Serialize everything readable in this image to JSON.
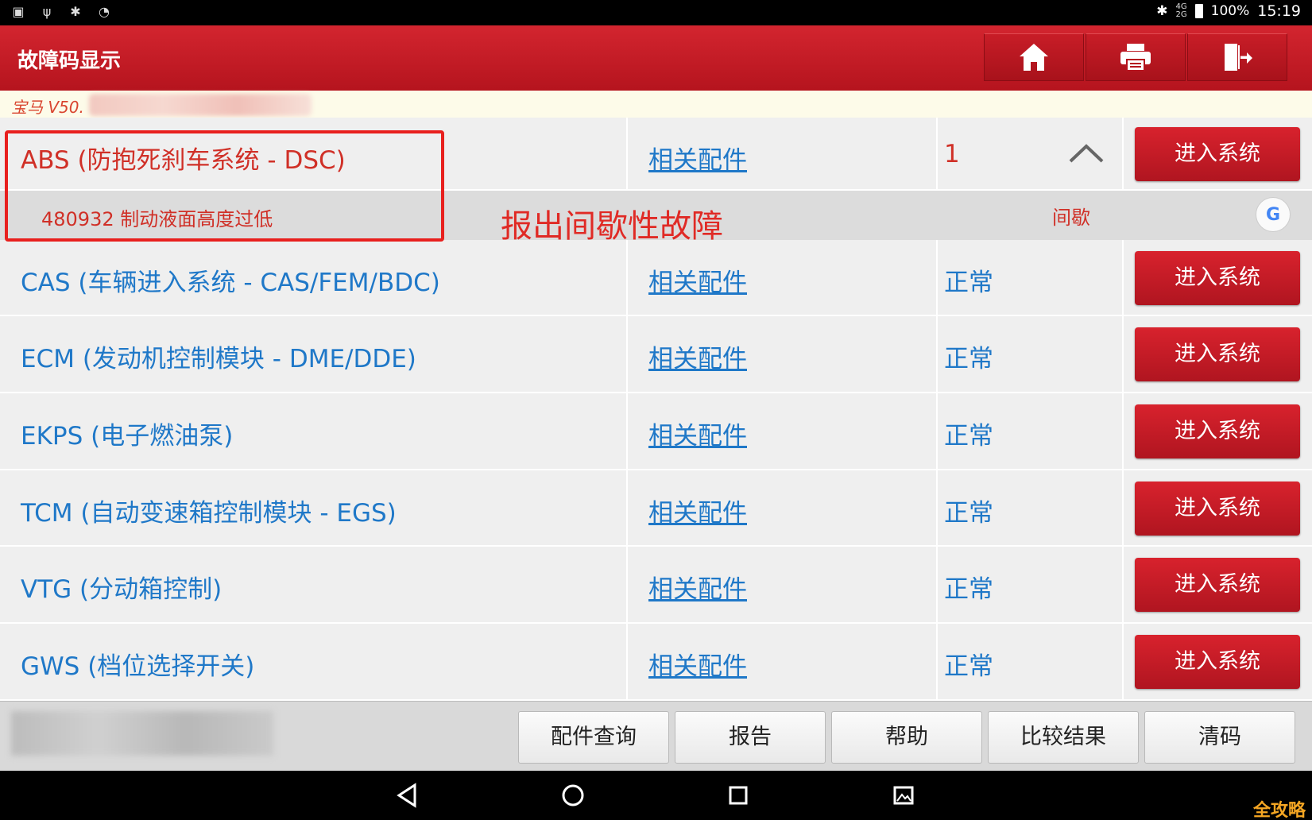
{
  "status_bar": {
    "battery": "100%",
    "time": "15:19",
    "network_top": "4G",
    "network_bottom": "2G"
  },
  "header": {
    "title": "故障码显示",
    "icons": [
      "home-icon",
      "print-icon",
      "exit-icon"
    ]
  },
  "vehicle": {
    "label": "宝马 V50."
  },
  "rows": [
    {
      "name": "ABS (防抱死刹车系统 - DSC)",
      "parts": "相关配件",
      "status": "1",
      "button": "进入系统"
    },
    {
      "name": "CAS (车辆进入系统 - CAS/FEM/BDC)",
      "parts": "相关配件",
      "status": "正常",
      "button": "进入系统"
    },
    {
      "name": "ECM (发动机控制模块 - DME/DDE)",
      "parts": "相关配件",
      "status": "正常",
      "button": "进入系统"
    },
    {
      "name": "EKPS (电子燃油泵)",
      "parts": "相关配件",
      "status": "正常",
      "button": "进入系统"
    },
    {
      "name": "TCM (自动变速箱控制模块 - EGS)",
      "parts": "相关配件",
      "status": "正常",
      "button": "进入系统"
    },
    {
      "name": "VTG (分动箱控制)",
      "parts": "相关配件",
      "status": "正常",
      "button": "进入系统"
    },
    {
      "name": "GWS (档位选择开关)",
      "parts": "相关配件",
      "status": "正常",
      "button": "进入系统"
    }
  ],
  "abs_detail": {
    "dtc": "480932 制动液面高度过低",
    "type": "间歇",
    "search_letter": "G"
  },
  "annotation": "报出间歇性故障",
  "toolbar": {
    "buttons": [
      "配件查询",
      "报告",
      "帮助",
      "比较结果",
      "清码"
    ]
  },
  "watermark": "全攻略",
  "colors": {
    "header_red": "#c41a24",
    "link_blue": "#1f78c8",
    "fault_red": "#d03027"
  }
}
